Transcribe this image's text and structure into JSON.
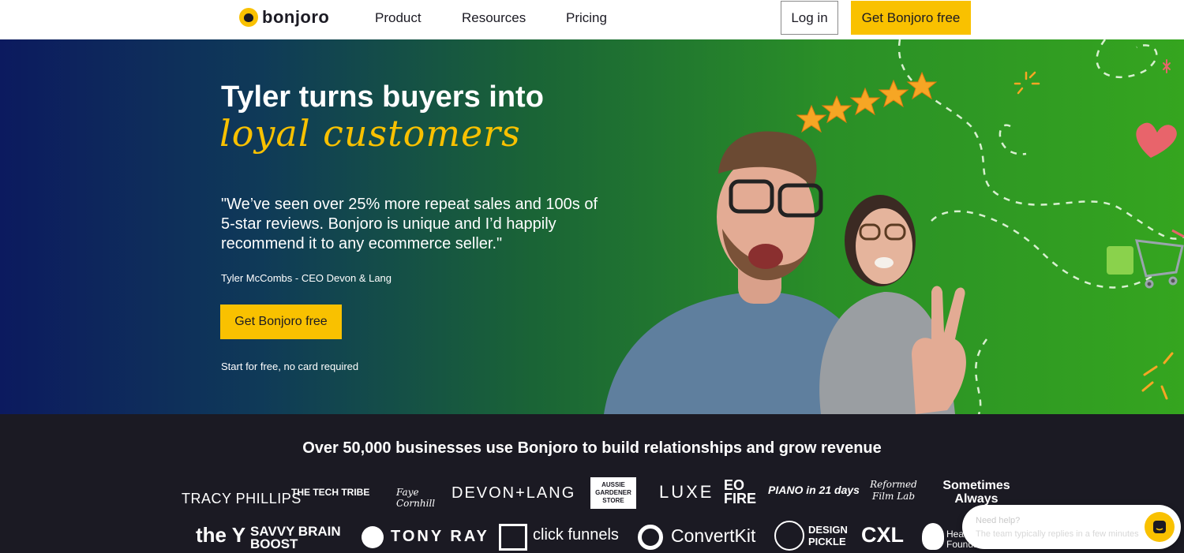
{
  "nav": {
    "logo_text": "bonjoro",
    "links": [
      "Product",
      "Resources",
      "Pricing"
    ],
    "login_label": "Log in",
    "cta_label": "Get Bonjoro free"
  },
  "hero": {
    "title": "Tyler turns buyers into",
    "script_title": "loyal customers",
    "quote": "\"We’ve seen over 25% more repeat sales and 100s of 5-star reviews. Bonjoro is unique and I’d happily recommend it to any ecommerce seller.\"",
    "author": "Tyler McCombs - CEO Devon & Lang",
    "cta_label": "Get Bonjoro free",
    "note": "Start for free, no card required"
  },
  "logos": {
    "heading": "Over 50,000 businesses use Bonjoro to build relationships and grow revenue",
    "row1": [
      "TRACY PHILLIPS",
      "THE TECH TRIBE",
      "Faye Cornhill",
      "DEVON+LANG",
      "AUSSIE GARDENER STORE",
      "LUXE",
      "EO FIRE",
      "PIANO in 21 days",
      "Reformed Film Lab",
      "Sometimes Always"
    ],
    "row2": [
      "the Y",
      "SAVVY BRAIN BOOST",
      "TONY RAY",
      "click funnels",
      "ConvertKit",
      "DESIGN PICKLE",
      "CXL",
      "Heart Foundation"
    ]
  },
  "chat": {
    "title": "Need help?",
    "subtitle": "The team typically replies in a few minutes"
  },
  "colors": {
    "accent": "#f9c100",
    "dark": "#1b1a23"
  }
}
